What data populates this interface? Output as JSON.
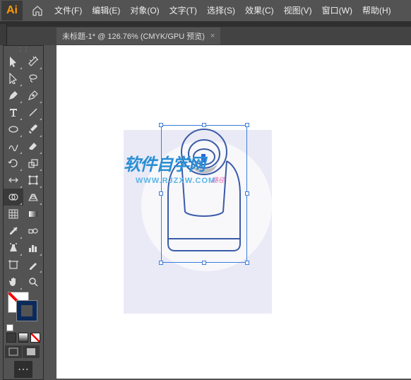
{
  "app": {
    "logo": "Ai"
  },
  "menu": {
    "file": "文件(F)",
    "edit": "编辑(E)",
    "object": "对象(O)",
    "type": "文字(T)",
    "select": "选择(S)",
    "effect": "效果(C)",
    "view": "视图(V)",
    "window": "窗口(W)",
    "help": "帮助(H)"
  },
  "tab": {
    "title": "未标题-1* @ 126.76% (CMYK/GPU 预览)",
    "close": "×"
  },
  "watermark": {
    "main": "软件自学网",
    "sub": "WWW.RJZXW.COM"
  },
  "colors": {
    "accent": "#3b7dd8",
    "stroke_swatch": "#0b2a5c",
    "artboard_bg": "#eaeaf7",
    "circle_bg": "#f8f8fb",
    "mini": [
      "#3a3a3a",
      "#b8b8b8",
      "#ffffff"
    ]
  },
  "zoom": "126.76%",
  "color_mode": "CMYK",
  "preview_mode": "GPU 预览",
  "tools": {
    "selection": "selection-tool",
    "direct_selection": "direct-selection-tool",
    "magic_wand": "magic-wand-tool",
    "lasso": "lasso-tool",
    "pen": "pen-tool",
    "curvature": "curvature-tool",
    "type": "type-tool",
    "line": "line-segment-tool",
    "ellipse": "ellipse-tool",
    "brush": "paintbrush-tool",
    "shaper": "shaper-tool",
    "eraser": "eraser-tool",
    "rotate": "rotate-tool",
    "scale": "scale-tool",
    "width": "width-tool",
    "free_transform": "free-transform-tool",
    "shape_builder": "shape-builder-tool",
    "perspective": "perspective-grid-tool",
    "mesh": "mesh-tool",
    "gradient": "gradient-tool",
    "eyedropper": "eyedropper-tool",
    "blend": "blend-tool",
    "symbol": "symbol-sprayer-tool",
    "graph": "column-graph-tool",
    "artboard": "artboard-tool",
    "slice": "slice-tool",
    "hand": "hand-tool",
    "zoom": "zoom-tool"
  }
}
